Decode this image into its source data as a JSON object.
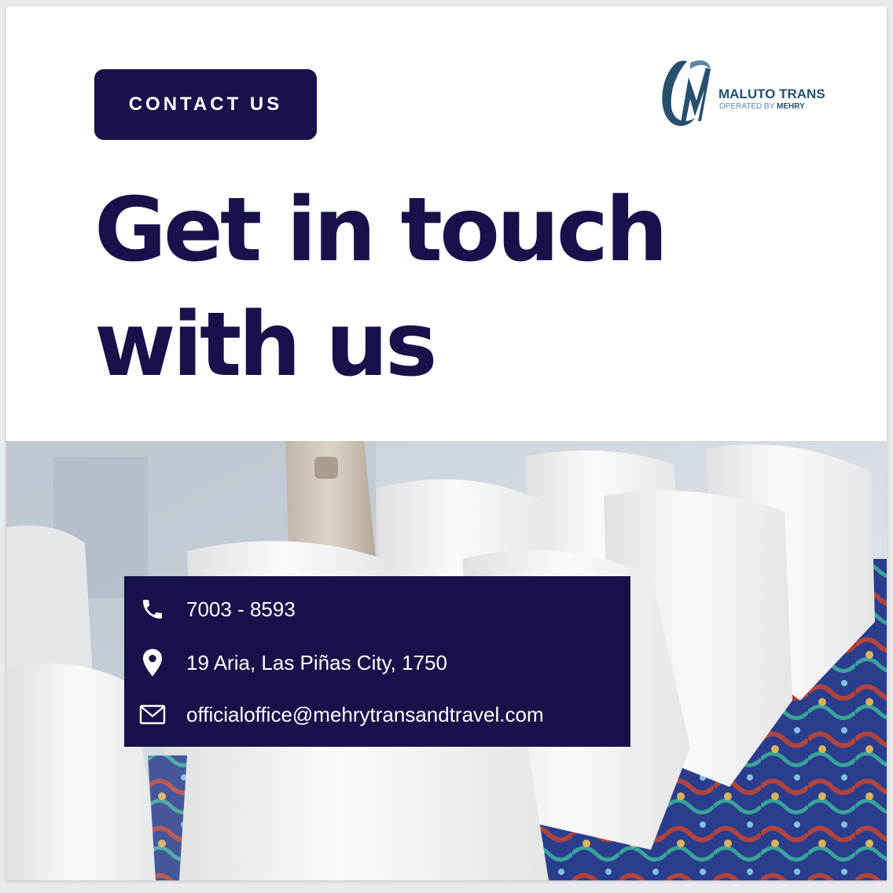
{
  "header": {
    "contact_label": "CONTACT US"
  },
  "logo": {
    "title": "MALUTO TRANS",
    "subtitle_prefix": "OPERATED BY",
    "subtitle_brand": "MEHRY",
    "color_primary": "#27506e",
    "color_secondary": "#5c87a8"
  },
  "headline": {
    "line1": "Get in touch",
    "line2": "with us"
  },
  "contact": {
    "phone": "7003 - 8593",
    "address": "19 Aria, Las Piñas City, 1750",
    "email": "officialoffice@mehrytransandtravel.com",
    "phone_icon": "phone-icon",
    "address_icon": "location-pin-icon",
    "email_icon": "envelope-icon"
  },
  "theme": {
    "navy": "#17124a",
    "white": "#ffffff"
  }
}
